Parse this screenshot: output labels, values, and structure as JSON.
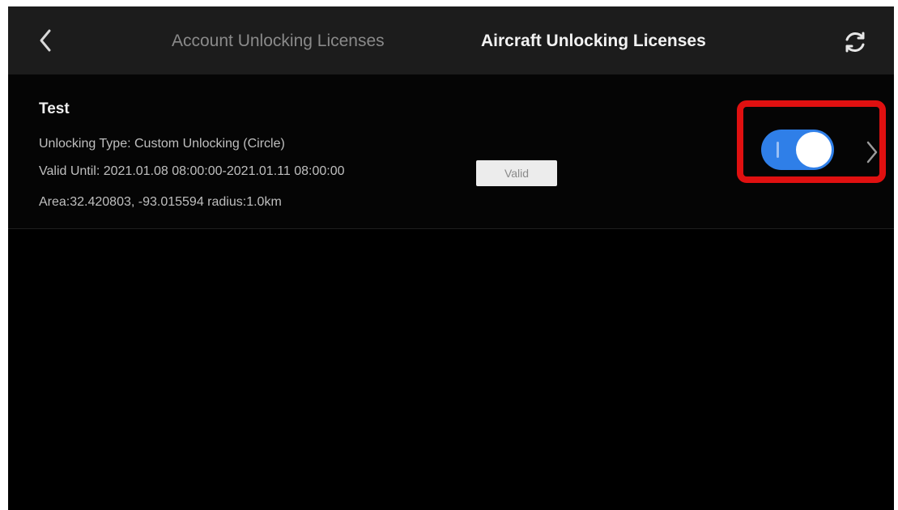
{
  "header": {
    "tabs": [
      {
        "label": "Account Unlocking Licenses",
        "active": false
      },
      {
        "label": "Aircraft Unlocking Licenses",
        "active": true
      }
    ],
    "back_icon": "chevron-left-icon",
    "sync_icon": "sync-icon"
  },
  "license": {
    "title": "Test",
    "unlocking_type": "Unlocking Type:  Custom Unlocking (Circle)",
    "valid_until": "Valid Until:  2021.01.08 08:00:00-2021.01.11 08:00:00",
    "status": "Valid",
    "area": "Area:32.420803, -93.015594  radius:1.0km",
    "enabled": true
  },
  "colors": {
    "background": "#000000",
    "header": "#1c1c1c",
    "toggle_on": "#2f7fe8",
    "highlight": "#e01010"
  }
}
